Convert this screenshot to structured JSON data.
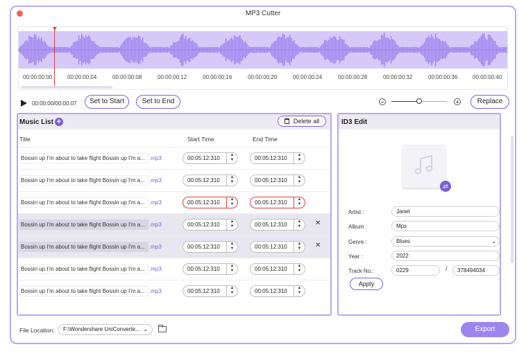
{
  "window": {
    "title": "MP3 Cutter"
  },
  "timeline": {
    "ticks": [
      "00:00:00:00",
      "00:00:00:04",
      "00:00:00:08",
      "00:00:00:12",
      "00:00:00:16",
      "00:00:00:20",
      "00:00:00:24",
      "00:00:00:28",
      "00:00:00:32",
      "00:00:00:36",
      "00:00:00:40"
    ]
  },
  "transport": {
    "time": "00:00:00/00:00:07",
    "set_start_label": "Set to Start",
    "set_end_label": "Set to End",
    "replace_label": "Replace",
    "zoom_level": 0.5
  },
  "music_list": {
    "title": "Music List",
    "delete_all_label": "Delete all",
    "columns": {
      "title": "Title",
      "start": "Start Time",
      "end": "End Time"
    },
    "rows": [
      {
        "name": "Bossin up I'm about to take flight Bossin up I'm a...",
        "ext": ".mp3",
        "start": "00:05:12:310",
        "end": "00:05:12:310"
      },
      {
        "name": "Bossin up I'm about to take flight Bossin up I'm a...",
        "ext": ".mp3",
        "start": "00:05:12:310",
        "end": "00:05:12:310"
      },
      {
        "name": "Bossin up I'm about to take flight Bossin up I'm a...",
        "ext": ".mp3",
        "start": "00:05:12:310",
        "end": "00:05:12:310"
      },
      {
        "name": "Bossin up I'm about to take flight Bossin up I'm a...",
        "ext": ".mp3",
        "start": "00:05:12:310",
        "end": "00:05:12:310"
      },
      {
        "name": "Bossin up I'm about to take flight Bossin up I'm a...",
        "ext": ".mp3",
        "start": "00:05:12:310",
        "end": "00:05:12:310"
      },
      {
        "name": "Bossin up I'm about to take flight Bossin up I'm a...",
        "ext": ".mp3",
        "start": "00:05:12:310",
        "end": "00:05:12:310"
      },
      {
        "name": "Bossin up I'm about to take flight Bossin up I'm a...",
        "ext": ".mp3",
        "start": "00:05:12:310",
        "end": "00:05:12:310"
      }
    ]
  },
  "id3": {
    "title": "ID3 Edit",
    "artist_label": "Artist :",
    "artist": "Janet",
    "album_label": "Album :",
    "album": "Mps",
    "genre_label": "Genre :",
    "genre": "Blues",
    "year_label": "Year :",
    "year": "2022",
    "track_label": "Track No.:",
    "track": "0229",
    "track_total": "378494034",
    "slash": "/",
    "apply_label": "Apply"
  },
  "footer": {
    "location_label": "File Location:",
    "location_value": "F:\\Wondershare UniConverte...",
    "export_label": "Export"
  },
  "colors": {
    "accent": "#7b5fd6",
    "border": "#b9a6f2",
    "error": "#e0403a",
    "export": "#9d85ef"
  }
}
